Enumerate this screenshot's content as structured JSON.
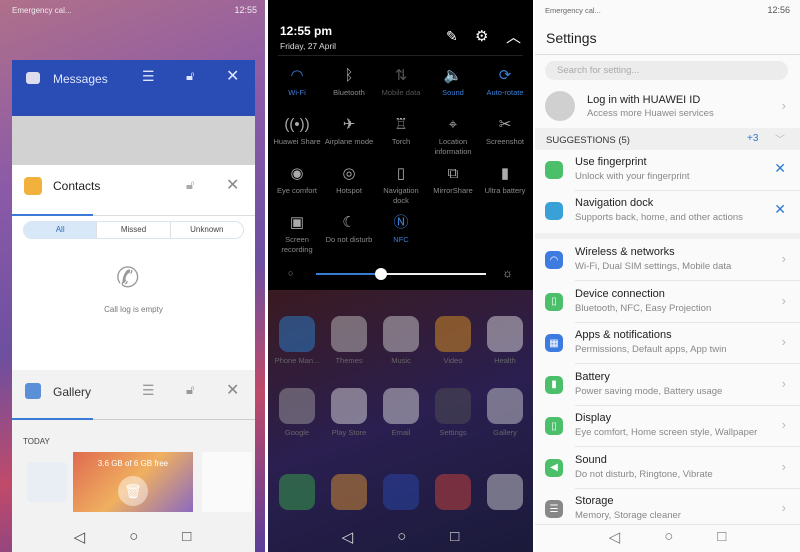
{
  "recents": {
    "status": {
      "carrier": "Emergency cal...",
      "time": "12:55"
    },
    "messages": {
      "title": "Messages",
      "color": "#2a4db5"
    },
    "contacts": {
      "title": "Contacts",
      "tabs": [
        "All",
        "Missed",
        "Unknown"
      ],
      "empty": "Call log is empty"
    },
    "gallery": {
      "title": "Gallery",
      "section": "TODAY",
      "storage": "3.6 GB of 6 GB free"
    }
  },
  "quick": {
    "time": "12:55 pm",
    "date": "Friday, 27 April",
    "brightness_percent": 38,
    "tiles": [
      {
        "label": "Wi-Fi",
        "icon": "wifi-icon",
        "glyph": "◠",
        "state": "on"
      },
      {
        "label": "Bluetooth",
        "icon": "bluetooth-icon",
        "glyph": "ᛒ",
        "state": "idle"
      },
      {
        "label": "Mobile data",
        "icon": "mobile-data-icon",
        "glyph": "⇅",
        "state": "off"
      },
      {
        "label": "Sound",
        "icon": "sound-icon",
        "glyph": "🔈",
        "state": "on"
      },
      {
        "label": "Auto-rotate",
        "icon": "auto-rotate-icon",
        "glyph": "⟳",
        "state": "on"
      },
      {
        "label": "Huawei Share",
        "icon": "huawei-share-icon",
        "glyph": "((•))",
        "state": "idle"
      },
      {
        "label": "Airplane mode",
        "icon": "airplane-icon",
        "glyph": "✈",
        "state": "idle"
      },
      {
        "label": "Torch",
        "icon": "torch-icon",
        "glyph": "♖",
        "state": "idle"
      },
      {
        "label": "Location information",
        "icon": "location-icon",
        "glyph": "⌖",
        "state": "idle"
      },
      {
        "label": "Screenshot",
        "icon": "screenshot-icon",
        "glyph": "✂",
        "state": "idle"
      },
      {
        "label": "Eye comfort",
        "icon": "eye-icon",
        "glyph": "◉",
        "state": "idle"
      },
      {
        "label": "Hotspot",
        "icon": "hotspot-icon",
        "glyph": "◎",
        "state": "idle"
      },
      {
        "label": "Navigation dock",
        "icon": "navigation-dock-icon",
        "glyph": "▯",
        "state": "idle"
      },
      {
        "label": "MirrorShare",
        "icon": "mirrorshare-icon",
        "glyph": "⧉",
        "state": "idle"
      },
      {
        "label": "Ultra battery",
        "icon": "battery-icon",
        "glyph": "▮",
        "state": "idle"
      },
      {
        "label": "Screen recording",
        "icon": "screen-recording-icon",
        "glyph": "▣",
        "state": "idle"
      },
      {
        "label": "Do not disturb",
        "icon": "moon-icon",
        "glyph": "☾",
        "state": "idle"
      },
      {
        "label": "NFC",
        "icon": "nfc-icon",
        "glyph": "Ⓝ",
        "state": "on"
      }
    ],
    "apps": [
      {
        "label": "Phone Man...",
        "color": "#2a8be0"
      },
      {
        "label": "Themes",
        "color": "#d0d0d0"
      },
      {
        "label": "Music",
        "color": "#e0e0e0"
      },
      {
        "label": "Video",
        "color": "#f0a020"
      },
      {
        "label": "Health",
        "color": "#f0f0f0"
      },
      {
        "label": "Google",
        "color": "#aaaaaa"
      },
      {
        "label": "Play Store",
        "color": "#eeeeee"
      },
      {
        "label": "Email",
        "color": "#e8e8e8"
      },
      {
        "label": "Settings",
        "color": "#555555"
      },
      {
        "label": "Gallery",
        "color": "#dddddd"
      }
    ],
    "dock": [
      "#3ab54a",
      "#f0a030",
      "#2a4db5",
      "#e04a3a",
      "#e0e0e0"
    ]
  },
  "settings": {
    "status": {
      "carrier": "Emergency cal...",
      "time": "12:56"
    },
    "title": "Settings",
    "search_placeholder": "Search for setting...",
    "account": {
      "title": "Log in with HUAWEI ID",
      "subtitle": "Access more Huawei services"
    },
    "suggestions_header": "SUGGESTIONS (5)",
    "suggestions_more": "+3",
    "suggestions": [
      {
        "title": "Use fingerprint",
        "subtitle": "Unlock with your fingerprint",
        "color": "#4cbf6a",
        "icon": "fingerprint-icon"
      },
      {
        "title": "Navigation dock",
        "subtitle": "Supports back, home, and other actions",
        "color": "#3aa0d8",
        "icon": "navigation-dock-icon"
      }
    ],
    "items": [
      {
        "title": "Wireless & networks",
        "subtitle": "Wi-Fi, Dual SIM settings, Mobile data",
        "color": "#3d7be0",
        "icon": "wifi-icon",
        "glyph": "◠"
      },
      {
        "title": "Device connection",
        "subtitle": "Bluetooth, NFC, Easy Projection",
        "color": "#4cbf6a",
        "icon": "device-connection-icon",
        "glyph": "▯"
      },
      {
        "title": "Apps & notifications",
        "subtitle": "Permissions, Default apps, App twin",
        "color": "#3d7be0",
        "icon": "apps-icon",
        "glyph": "▦"
      },
      {
        "title": "Battery",
        "subtitle": "Power saving mode, Battery usage",
        "color": "#4cbf6a",
        "icon": "battery-icon",
        "glyph": "▮"
      },
      {
        "title": "Display",
        "subtitle": "Eye comfort, Home screen style, Wallpaper",
        "color": "#4cbf6a",
        "icon": "display-icon",
        "glyph": "▯"
      },
      {
        "title": "Sound",
        "subtitle": "Do not disturb, Ringtone, Vibrate",
        "color": "#4cbf6a",
        "icon": "sound-icon",
        "glyph": "◀"
      },
      {
        "title": "Storage",
        "subtitle": "Memory, Storage cleaner",
        "color": "#888888",
        "icon": "storage-icon",
        "glyph": "☰"
      }
    ]
  }
}
